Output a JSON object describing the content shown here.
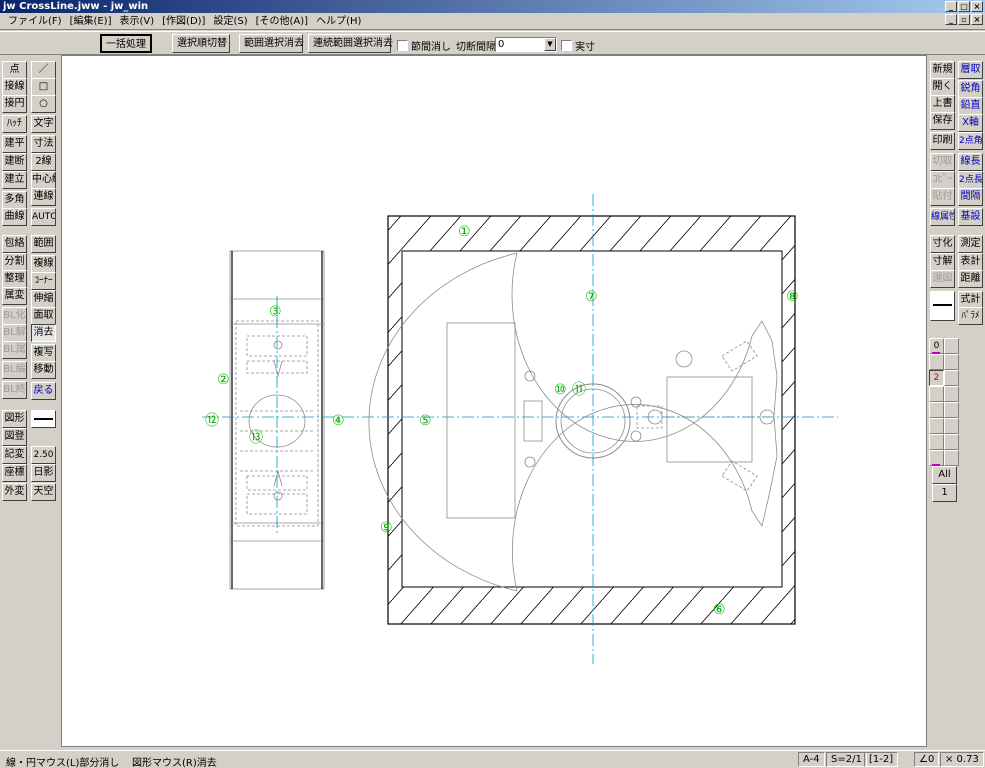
{
  "window": {
    "title": "jw CrossLine.jww - jw_win",
    "controls": [
      "_",
      "□",
      "×"
    ]
  },
  "menubar": {
    "items": [
      "ファイル(F)",
      "[編集(E)]",
      "表示(V)",
      "[作図(D)]",
      "設定(S)",
      "[その他(A)]",
      "ヘルプ(H)"
    ],
    "right_controls": [
      "_",
      "▫",
      "×"
    ]
  },
  "toolbar": {
    "batch_label": "一括処理",
    "select_order_label": "選択順切替",
    "range_select_erase_label": "範囲選択消去",
    "continuous_range_erase_label": "連続範囲選択消去",
    "section_erase_label": "節間消し",
    "cut_interval_label": "切断間隔",
    "cut_interval_value": "0",
    "actual_size_label": "実寸"
  },
  "left_panel": {
    "col1": [
      "点",
      "接線",
      "接円",
      "ﾊｯﾁ",
      "建平",
      "建断",
      "建立",
      "多角",
      "曲線",
      "包絡",
      "分割",
      "整理",
      "属変",
      "BL化",
      "BL解",
      "BL属",
      "BL編",
      "BL終",
      "図形",
      "図登",
      "記変",
      "座標",
      "外変"
    ],
    "col2": [
      "／",
      "□",
      "○",
      "文字",
      "寸法",
      "2線",
      "中心線",
      "連線",
      "AUTO",
      "範囲",
      "複線",
      "ｺｰﾅｰ",
      "伸縮",
      "面取",
      "消去",
      "複写",
      "移動",
      "戻る",
      "2.50",
      "日影",
      "天空"
    ]
  },
  "right_panel": {
    "col1": [
      "新規",
      "開く",
      "上書",
      "保存",
      "印刷",
      "切取",
      "ｺﾋﾟｰ",
      "貼付",
      "線属性",
      "寸化",
      "寸解",
      "選図",
      "",
      "",
      "All",
      "1"
    ],
    "col2": [
      "層取",
      "鋭角",
      "鉛直",
      "X軸",
      "2点角",
      "線長",
      "2点長",
      "間隔",
      "基設",
      "測定",
      "表計",
      "距離",
      "式計",
      "ﾊﾟﾗﾒ"
    ],
    "layer_active": "2",
    "layer_zero": "0"
  },
  "drawing": {
    "labels": [
      "①",
      "②",
      "③",
      "④",
      "⑤",
      "⑥",
      "⑦",
      "⑧",
      "⑨",
      "⑩",
      "⑪",
      "⑫",
      "⑬"
    ]
  },
  "statusbar": {
    "hint_left": "線・円マウス(L)部分消し",
    "hint_right": "図形マウス(R)消去",
    "paper": "A-4",
    "scale": "S=2/1",
    "layer": "[1-2]",
    "angle": "∠0",
    "factor": "× 0.73"
  },
  "colors": {
    "annotation_green": "#00b000",
    "centerline_cyan": "#00a0c0",
    "linework": "#000000",
    "grey_line": "#8c8c8c"
  }
}
